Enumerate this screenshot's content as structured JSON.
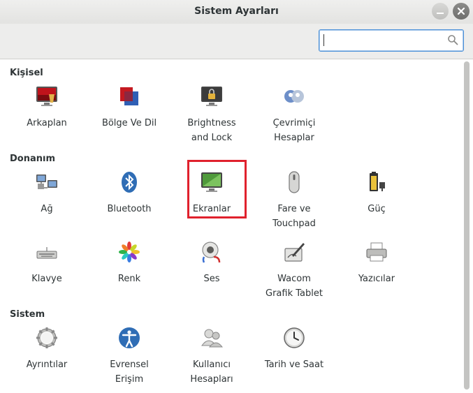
{
  "window": {
    "title": "Sistem Ayarları"
  },
  "search": {
    "value": "",
    "placeholder": ""
  },
  "sections": {
    "personal": "Kişisel",
    "hardware": "Donanım",
    "system": "Sistem"
  },
  "items": {
    "background": "Arkaplan",
    "region": "Bölge Ve Dil",
    "brightness": "Brightness\nand Lock",
    "online_accounts": "Çevrimiçi\nHesaplar",
    "network": "Ağ",
    "bluetooth": "Bluetooth",
    "displays": "Ekranlar",
    "mouse": "Fare ve\nTouchpad",
    "power": "Güç",
    "keyboard": "Klavye",
    "color": "Renk",
    "sound": "Ses",
    "wacom": "Wacom\nGrafik Tablet",
    "printers": "Yazıcılar",
    "details": "Ayrıntılar",
    "universal_access": "Evrensel\nErişim",
    "users": "Kullanıcı\nHesapları",
    "datetime": "Tarih ve Saat"
  },
  "highlight_color": "#e0212d",
  "accent_color": "#4a90d9"
}
